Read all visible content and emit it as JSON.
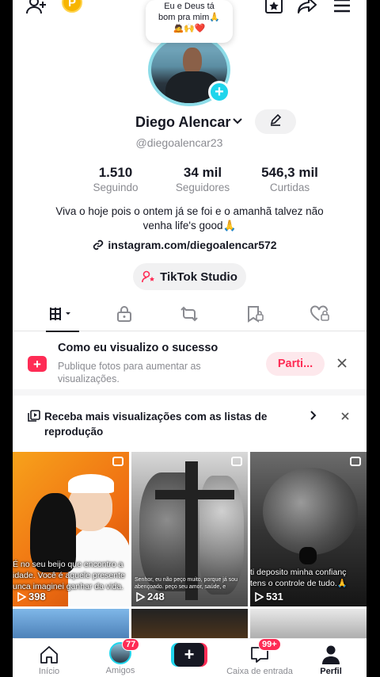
{
  "note": {
    "text_line1": "Eu e Deus tá",
    "text_line2": "bom pra mim🙏",
    "emojis": "🙇🙌❤️"
  },
  "profile": {
    "name": "Diego Alencar",
    "username": "@diegoalencar23",
    "bio_line1": "Viva o hoje pois o ontem já se foi e o amanhã talvez não",
    "bio_line2": "venha life's good🙏",
    "link": "instagram.com/diegoalencar572",
    "studio_label": "TikTok Studio"
  },
  "stats": [
    {
      "value": "1.510",
      "label": "Seguindo"
    },
    {
      "value": "34 mil",
      "label": "Seguidores"
    },
    {
      "value": "546,3 mil",
      "label": "Curtidas"
    }
  ],
  "banner1": {
    "title": "Como eu visualizo o sucesso",
    "subtitle": "Publique fotos para aumentar as visualizações.",
    "button": "Parti..."
  },
  "banner2": {
    "text": "Receba mais visualizações com as listas de reprodução"
  },
  "videos": [
    {
      "caption": "É no seu beijo que encontro a",
      "caption2": "idade. Você é aquele presente",
      "caption3": "unca imaginei ganhar da vida.",
      "views": "398"
    },
    {
      "caption_small": "Senhor, eu não peço muito, porque já sou abençoado. peço seu amor, saúde, e",
      "views": "248"
    },
    {
      "caption": "ti deposito minha confianç",
      "caption2": "tens o controle de tudo.🙏",
      "views": "531"
    }
  ],
  "nav": {
    "home": "Início",
    "friends": "Amigos",
    "friends_count": "77",
    "inbox": "Caixa de entrada",
    "inbox_count": "99+",
    "profile": "Perfil"
  },
  "colors": {
    "accent_pink": "#fe2c55",
    "accent_cyan": "#20d5ec",
    "coin": "#f7b500"
  }
}
